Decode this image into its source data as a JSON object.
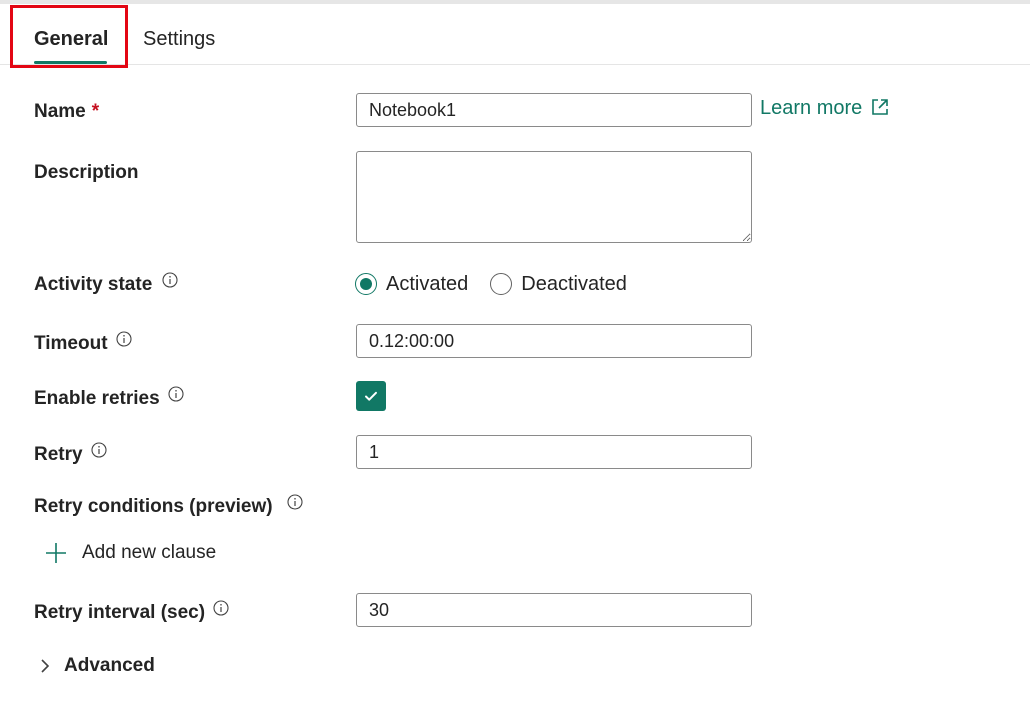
{
  "tabs": [
    {
      "label": "General",
      "active": true
    },
    {
      "label": "Settings",
      "active": false
    }
  ],
  "accent_color": "#117865",
  "highlight_color": "#e30613",
  "form": {
    "name": {
      "label": "Name",
      "required_marker": "*",
      "value": "Notebook1"
    },
    "learn_more": {
      "label": "Learn more",
      "icon": "external-link-icon"
    },
    "description": {
      "label": "Description",
      "value": ""
    },
    "activity_state": {
      "label": "Activity state",
      "icon": "info-icon",
      "options": [
        "Activated",
        "Deactivated"
      ],
      "selected": "Activated"
    },
    "timeout": {
      "label": "Timeout",
      "icon": "info-icon",
      "value": "0.12:00:00"
    },
    "enable_retries": {
      "label": "Enable retries",
      "icon": "info-icon",
      "checked": true
    },
    "retry": {
      "label": "Retry",
      "icon": "info-icon",
      "value": "1"
    },
    "retry_conditions": {
      "label": "Retry conditions (preview)",
      "icon": "info-icon"
    },
    "add_clause": {
      "label": "Add new clause",
      "icon": "plus-icon"
    },
    "retry_interval": {
      "label": "Retry interval (sec)",
      "icon": "info-icon",
      "value": "30"
    },
    "advanced": {
      "label": "Advanced",
      "icon": "chevron-right-icon"
    }
  }
}
